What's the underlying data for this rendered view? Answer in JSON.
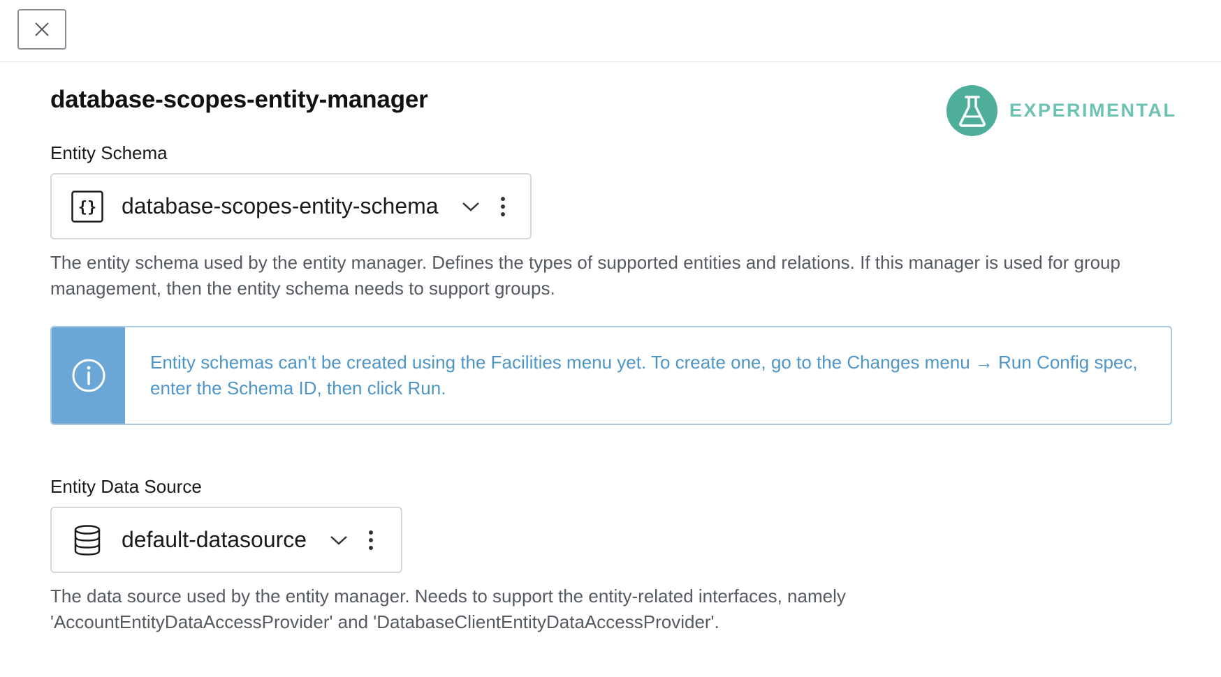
{
  "header": {
    "close_label": "close"
  },
  "page": {
    "title": "database-scopes-entity-manager",
    "badge": "EXPERIMENTAL"
  },
  "entity_schema": {
    "label": "Entity Schema",
    "value": "database-scopes-entity-schema",
    "icon": "braces-icon",
    "help": "The entity schema used by the entity manager. Defines the types of supported entities and relations. If this manager is used for group management, then the entity schema needs to support groups."
  },
  "info": {
    "icon": "info-icon",
    "text": "Entity schemas can't be created using the Facilities menu yet. To create one, go to the Changes menu → Run Config spec, enter the Schema ID, then click Run."
  },
  "entity_data_source": {
    "label": "Entity Data Source",
    "value": "default-datasource",
    "icon": "database-icon",
    "help": "The data source used by the entity manager. Needs to support the entity-related interfaces, namely 'AccountEntityDataAccessProvider' and 'DatabaseClientEntityDataAccessProvider'."
  },
  "colors": {
    "accent_teal": "#4eae9a",
    "badge_text": "#6cc2b3",
    "info_blue": "#6aa7d6",
    "info_text": "#4f96c7"
  }
}
